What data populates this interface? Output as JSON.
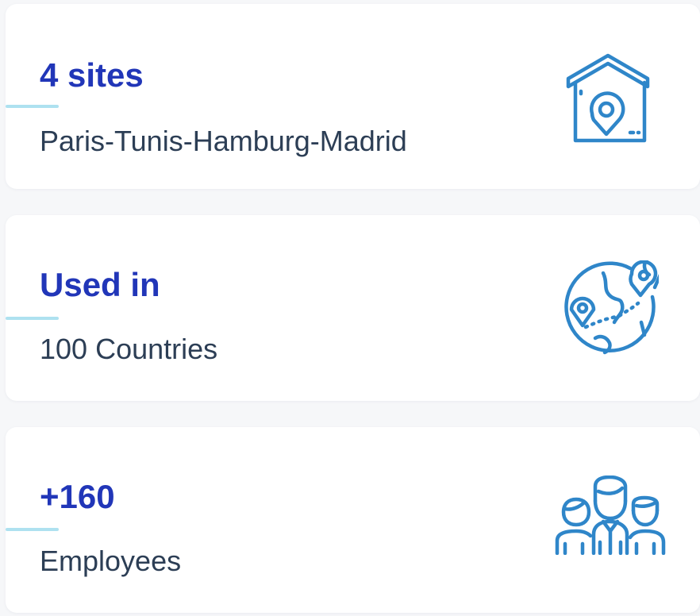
{
  "accent_color": "#2136b8",
  "icon_color": "#2f86c9",
  "line_color": "#aee1f0",
  "stats": [
    {
      "value": "4 sites",
      "label": "Paris-Tunis-Hamburg-Madrid",
      "icon": "house-location-icon"
    },
    {
      "value": "Used in",
      "label": "100 Countries",
      "icon": "globe-location-icon"
    },
    {
      "value": "+160",
      "label": "Employees",
      "icon": "team-people-icon"
    }
  ]
}
